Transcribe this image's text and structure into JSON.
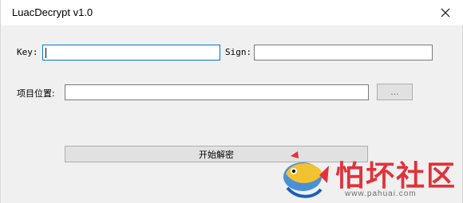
{
  "window": {
    "title": "LuacDecrypt v1.0"
  },
  "form": {
    "key_label": "Key:",
    "key_value": "",
    "sign_label": "Sign:",
    "sign_value": "",
    "path_label": "项目位置:",
    "path_value": "",
    "browse_label": "...",
    "start_label": "开始解密"
  },
  "watermark": {
    "text": "怕坏社区",
    "url": "www.pahuai.com"
  },
  "icons": {
    "close": "close-icon",
    "logo": "fish-logo"
  }
}
